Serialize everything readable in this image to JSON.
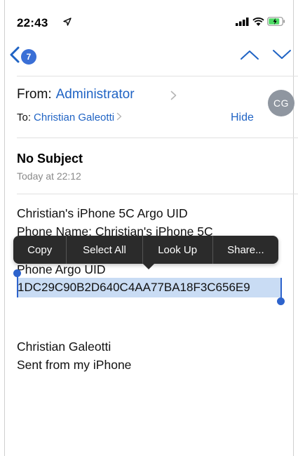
{
  "status_bar": {
    "time": "22:43"
  },
  "nav": {
    "back_count": "7"
  },
  "header": {
    "from_label": "From:",
    "from_name": "Administrator",
    "to_label": "To:",
    "to_name": "Christian Galeotti",
    "hide_label": "Hide",
    "avatar_initials": "CG"
  },
  "message": {
    "subject": "No Subject",
    "date": "Today at 22:12",
    "lines": [
      "Christian's iPhone 5C Argo UID",
      "Phone Name: Christian's iPhone 5C",
      "Phone Argo UID",
      "1DC29C90B2D640C4AA77BA18F3C656E9",
      "Christian Galeotti",
      "Sent from my iPhone"
    ]
  },
  "edit_menu": {
    "items": [
      "Copy",
      "Select All",
      "Look Up",
      "Share..."
    ]
  },
  "colors": {
    "accent": "#1f63c4",
    "selection": "#c9dcf4",
    "menu_bg": "#2b2b2b",
    "avatar_bg": "#8f96a0"
  }
}
